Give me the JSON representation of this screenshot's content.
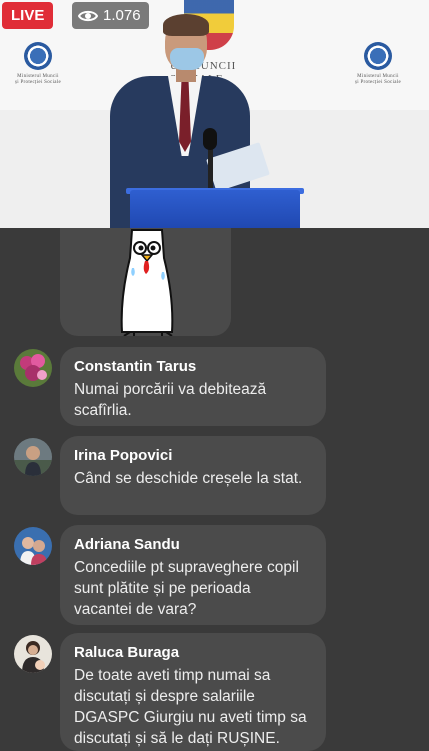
{
  "stream": {
    "live_label": "LIVE",
    "viewer_count": "1.076"
  },
  "backdrop": {
    "logo_left": "Ministerul Muncii\nși Protecției Sociale",
    "logo_right": "Ministerul Muncii\nși Protecției Sociale",
    "center_text": "UL MUNCII\nSOCIALE"
  },
  "comments": [
    {
      "name": "Constantin Tarus",
      "message": "Numai porcării va debitează scafîrlia."
    },
    {
      "name": "Irina Popovici",
      "message": "Când se deschide creșele la stat."
    },
    {
      "name": "Adriana Sandu",
      "message": "Concediile pt supraveghere copil sunt plătite și pe perioada vacantei de vara?"
    },
    {
      "name": "Raluca Buraga",
      "message": "De toate aveti timp numai sa discutați și despre salariile DGASPC Giurgiu nu aveti timp sa discutați și să le dați RUȘINE."
    }
  ]
}
